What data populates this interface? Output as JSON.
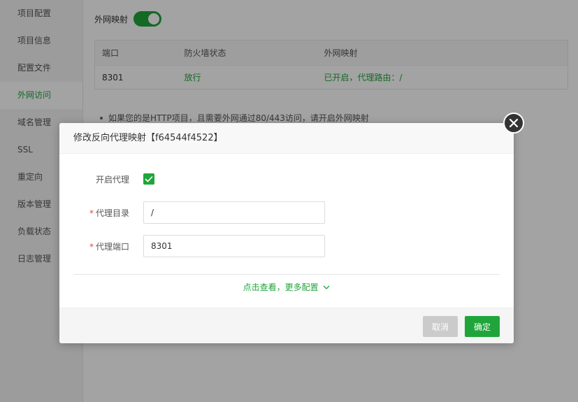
{
  "sidebar": {
    "items": [
      {
        "label": "项目配置",
        "active": false
      },
      {
        "label": "项目信息",
        "active": false
      },
      {
        "label": "配置文件",
        "active": false
      },
      {
        "label": "外网访问",
        "active": true
      },
      {
        "label": "域名管理",
        "active": false
      },
      {
        "label": "SSL",
        "active": false
      },
      {
        "label": "重定向",
        "active": false
      },
      {
        "label": "版本管理",
        "active": false
      },
      {
        "label": "负载状态",
        "active": false
      },
      {
        "label": "日志管理",
        "active": false
      }
    ]
  },
  "main": {
    "toggle_label": "外网映射",
    "toggle_on": true,
    "table": {
      "headers": [
        "端口",
        "防火墙状态",
        "外网映射"
      ],
      "rows": [
        [
          "8301",
          "放行",
          "已开启，代理路由：/"
        ]
      ]
    },
    "tips": [
      "如果您的是HTTP项目，且需要外网通过80/443访问，请开启外网映射"
    ]
  },
  "dialog": {
    "title": "修改反向代理映射【f64544f4522】",
    "enable_proxy_label": "开启代理",
    "enable_proxy_checked": true,
    "proxy_dir_label": "代理目录",
    "proxy_dir_value": "/",
    "proxy_port_label": "代理端口",
    "proxy_port_value": "8301",
    "more_link": "点击查看，更多配置",
    "cancel_label": "取消",
    "ok_label": "确定"
  },
  "colors": {
    "accent": "#20a53a",
    "required": "#e8453c",
    "cancel_button": "#cbcbcb"
  }
}
